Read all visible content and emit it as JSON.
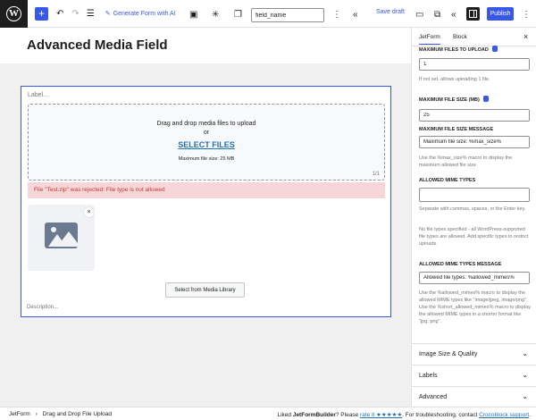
{
  "toolbar": {
    "add_label": "+",
    "undo_icon": "undo-icon",
    "redo_icon": "redo-icon",
    "list_icon": "list-view-icon",
    "generate_ai_label": "Generate Form with AI",
    "field_name_value": "field_name",
    "save_draft_label": "Save draft",
    "publish_label": "Publish"
  },
  "page": {
    "title": "Advanced Media Field"
  },
  "block": {
    "label_placeholder": "Label...",
    "dropzone_text": "Drag and drop media files to upload",
    "dropzone_or": "or",
    "select_files_label": "SELECT FILES",
    "max_file_size_text": "Maximum file size: 25 MB",
    "file_count": "1/1",
    "error_message": "File \"Test.zip\" was rejected: File type is not allowed",
    "thumb_close": "×",
    "media_library_button": "Select from Media Library",
    "description_placeholder": "Description..."
  },
  "sidebar": {
    "tabs": [
      "JetForm",
      "Block"
    ],
    "close_label": "×",
    "max_files_label": "MAXIMUM FILES TO UPLOAD",
    "max_files_value": "1",
    "max_files_help": "If not set, allows uploading 1 file.",
    "max_size_label": "MAXIMUM FILE SIZE (MB)",
    "max_size_value": "25",
    "max_size_msg_label": "MAXIMUM FILE SIZE MESSAGE",
    "max_size_msg_value": "Maximum file size: %max_size%",
    "max_size_msg_help": "Use the %max_size% macro to display the maximum allowed file size",
    "mime_label": "ALLOWED MIME TYPES",
    "mime_value": "",
    "mime_help1": "Separate with commas, spaces, or the Enter key.",
    "mime_help2": "No file types specified - all WordPress-supported file types are allowed. Add specific types to restrict uploads.",
    "mime_msg_label": "ALLOWED MIME TYPES MESSAGE",
    "mime_msg_value": "Allowed file types: %allowed_mimes%",
    "mime_msg_help": "Use the %allowed_mimes% macro to display the allowed MIME types like \"image/jpeg, image/png\". Use the %short_allowed_mimes% macro to display the allowed MIME types in a shorter format like \"jpg, png\".",
    "panels": [
      "Image Size & Quality",
      "Labels",
      "Advanced"
    ]
  },
  "footer": {
    "breadcrumb": [
      "JetForm",
      "›",
      "Drag and Drop File Upload"
    ],
    "credit_prefix": "Liked ",
    "credit_brand": "JetFormBuilder",
    "credit_mid": "? Please ",
    "credit_rate": "rate it ★★★★★",
    "credit_suffix": ". For troubleshooting, contact ",
    "credit_support": "Crocoblock support",
    "credit_end": "."
  },
  "colors": {
    "accent": "#3858e9",
    "error_bg": "#f7d6d9",
    "error_text": "#c0392b",
    "link": "#2271b1"
  }
}
